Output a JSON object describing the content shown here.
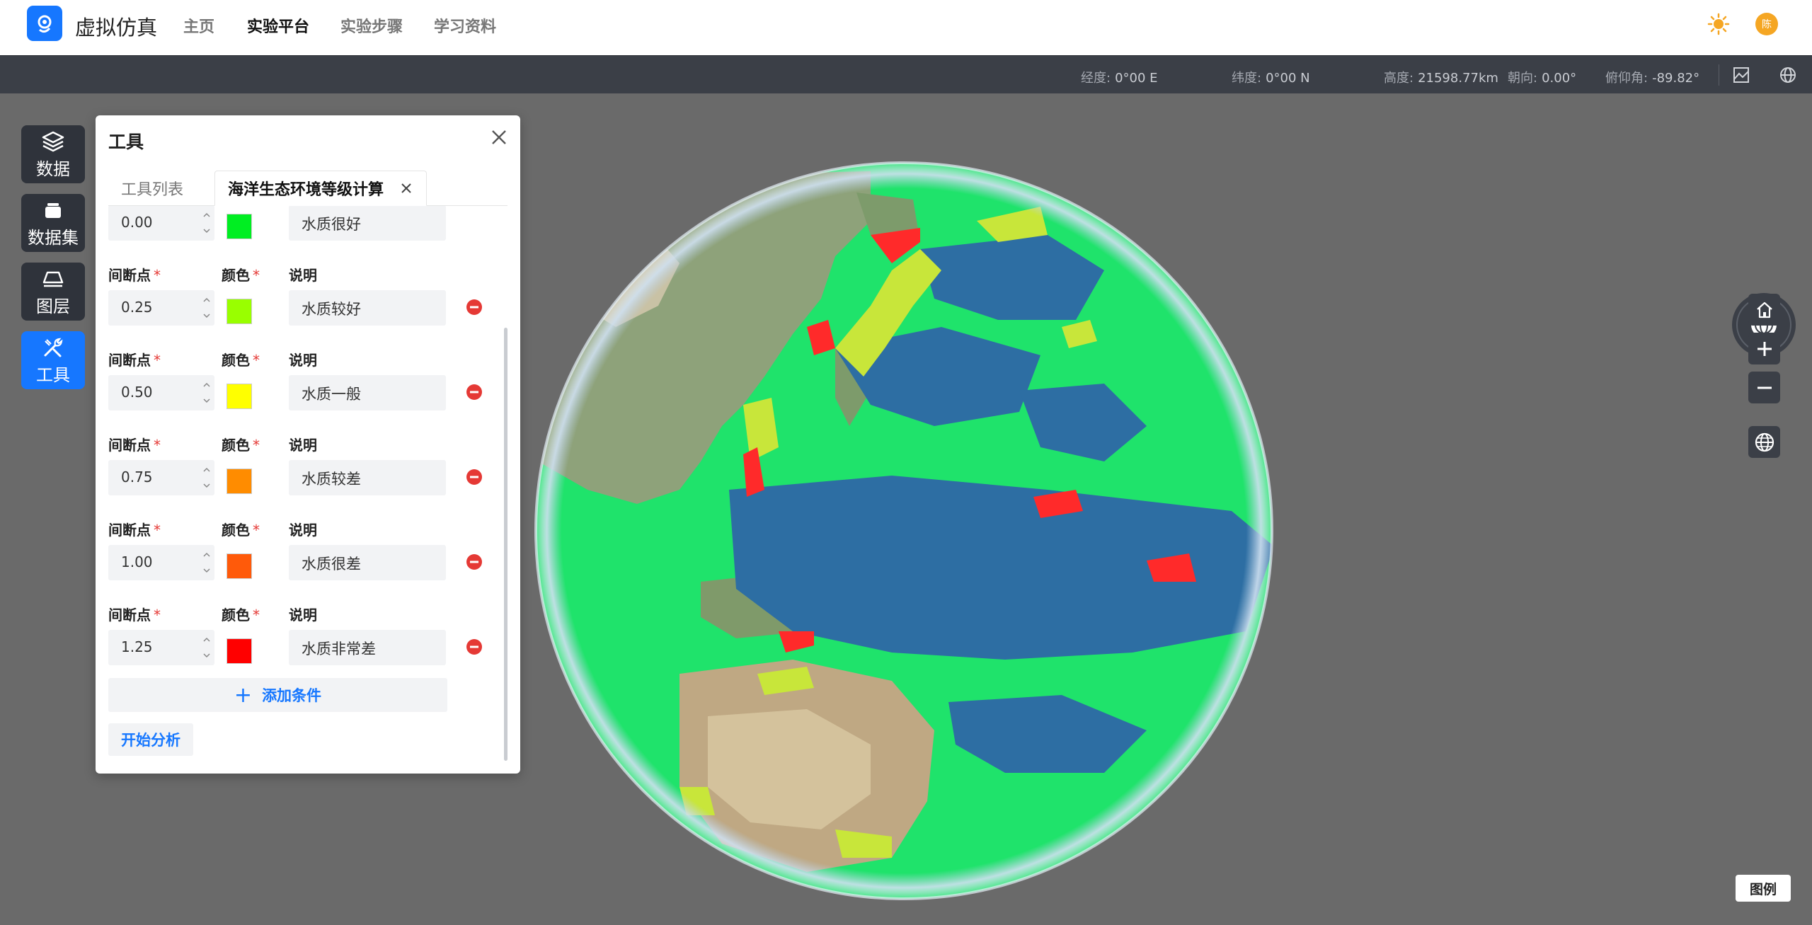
{
  "app": {
    "brand": "虚拟仿真",
    "logo_icon": "experiment-logo-icon",
    "avatar_text": "陈"
  },
  "nav": {
    "items": [
      {
        "label": "主页",
        "active": false
      },
      {
        "label": "实验平台",
        "active": true
      },
      {
        "label": "实验步骤",
        "active": false
      },
      {
        "label": "学习资料",
        "active": false
      }
    ]
  },
  "status": {
    "lon_label": "经度:",
    "lon": "0°00 E",
    "lat_label": "纬度:",
    "lat": "0°00 N",
    "alt_label": "高度:",
    "alt": "21598.77km",
    "heading_label": "朝向:",
    "heading": "0.00°",
    "pitch_label": "俯仰角:",
    "pitch": "-89.82°"
  },
  "sidebar": {
    "items": [
      {
        "label": "数据",
        "icon": "layers-icon",
        "active": false
      },
      {
        "label": "数据集",
        "icon": "dataset-icon",
        "active": false
      },
      {
        "label": "图层",
        "icon": "layer-plane-icon",
        "active": false
      },
      {
        "label": "工具",
        "icon": "tools-icon",
        "active": true
      }
    ]
  },
  "panel": {
    "title": "工具",
    "tabs": [
      {
        "label": "工具列表",
        "active": false
      },
      {
        "label": "海洋生态环境等级计算",
        "active": true
      }
    ],
    "labels": {
      "breakpoint": "间断点",
      "required": "*",
      "color": "颜色",
      "desc": "说明"
    },
    "rows": [
      {
        "breakpoint": "0.00",
        "color": "#00ee22",
        "desc": "水质很好",
        "show_labels": false
      },
      {
        "breakpoint": "0.25",
        "color": "#99ff00",
        "desc": "水质较好",
        "show_labels": true
      },
      {
        "breakpoint": "0.50",
        "color": "#ffff00",
        "desc": "水质一般",
        "show_labels": true
      },
      {
        "breakpoint": "0.75",
        "color": "#ff8c00",
        "desc": "水质较差",
        "show_labels": true
      },
      {
        "breakpoint": "1.00",
        "color": "#ff5a0a",
        "desc": "水质很差",
        "show_labels": true
      },
      {
        "breakpoint": "1.25",
        "color": "#ff0000",
        "desc": "水质非常差",
        "show_labels": true
      }
    ],
    "add_label": "添加条件",
    "start_label": "开始分析"
  },
  "controls": {
    "compass_label": "N",
    "legend_label": "图例"
  },
  "map_colors": {
    "ocean": "#2d6ea3",
    "good": "#1fe36b",
    "fair": "#c8e63a",
    "poor": "#ff2a2a",
    "land": "#8ea27a"
  }
}
